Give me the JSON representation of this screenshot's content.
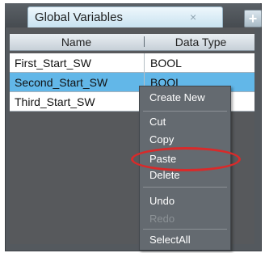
{
  "tab": {
    "title": "Global Variables",
    "close_glyph": "×",
    "add_glyph": "+"
  },
  "table": {
    "headers": [
      "Name",
      "Data Type"
    ],
    "rows": [
      {
        "name": "First_Start_SW",
        "type": "BOOL"
      },
      {
        "name": "Second_Start_SW",
        "type": "BOOL"
      },
      {
        "name": "Third_Start_SW",
        "type": ""
      }
    ]
  },
  "context_menu": {
    "items": [
      "Create New",
      "Cut",
      "Copy",
      "Paste",
      "Delete",
      "Undo",
      "Redo",
      "SelectAll"
    ],
    "disabled": [
      "Redo"
    ]
  },
  "colors": {
    "selected_row": "#62b7e8",
    "highlight_ring": "#d92a2a"
  }
}
